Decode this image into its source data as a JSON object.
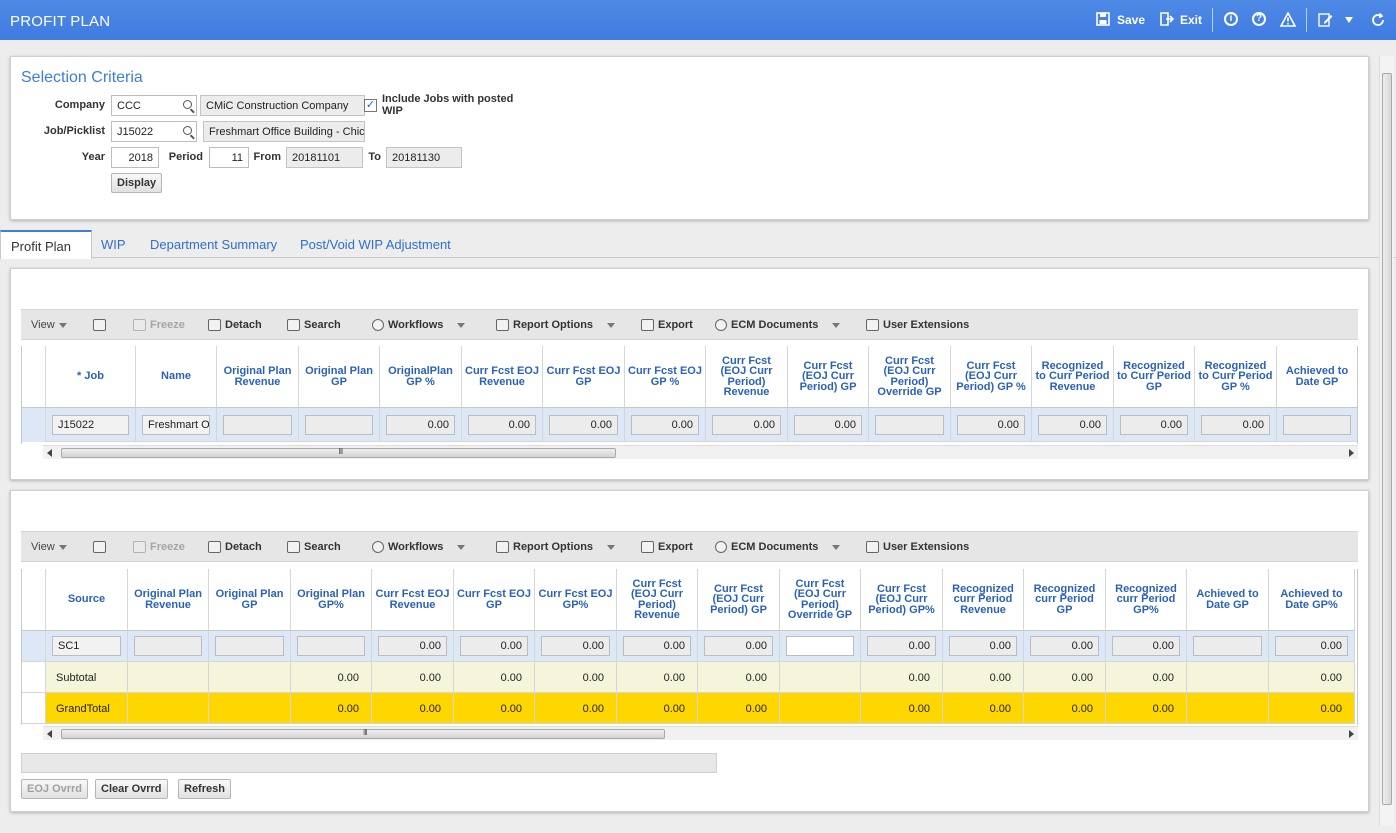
{
  "app": {
    "title": "PROFIT PLAN",
    "save_label": "Save",
    "exit_label": "Exit"
  },
  "selection": {
    "title": "Selection Criteria",
    "company_label": "Company",
    "company_code": "CCC",
    "company_name": "CMiC Construction Company",
    "include_wip_label_1": "Include Jobs with posted",
    "include_wip_label_2": "WIP",
    "include_wip_checked": "✓",
    "job_label": "Job/Picklist",
    "job_code": "J15022",
    "job_name": "Freshmart Office Building - Chic",
    "year_label": "Year",
    "year_value": "2018",
    "period_label": "Period",
    "period_value": "11",
    "from_label": "From",
    "from_value": "20181101",
    "to_label": "To",
    "to_value": "20181130",
    "display_button": "Display"
  },
  "tabs": [
    "Profit Plan",
    "WIP",
    "Department Summary",
    "Post/Void WIP Adjustment"
  ],
  "toolbar": {
    "view": "View",
    "freeze": "Freeze",
    "detach": "Detach",
    "search": "Search",
    "workflows": "Workflows",
    "report_options": "Report Options",
    "export": "Export",
    "ecm_documents": "ECM Documents",
    "user_extensions": "User Extensions"
  },
  "grid1": {
    "headers": [
      "* Job",
      "Name",
      "Original Plan Revenue",
      "Original Plan GP",
      "OriginalPlan GP %",
      "Curr Fcst EOJ Revenue",
      "Curr Fcst EOJ GP",
      "Curr Fcst EOJ GP %",
      "Curr Fcst (EOJ Curr Period) Revenue",
      "Curr Fcst (EOJ Curr Period) GP",
      "Curr Fcst (EOJ Curr Period) Override GP",
      "Curr Fcst (EOJ Curr Period) GP %",
      "Recognized to Curr Period Revenue",
      "Recognized to Curr Period GP",
      "Recognized to Curr Period GP %",
      "Achieved to Date GP"
    ],
    "row": [
      "J15022",
      "Freshmart Office Building - Chicago",
      "",
      "",
      "0.00",
      "0.00",
      "0.00",
      "0.00",
      "0.00",
      "0.00",
      "",
      "0.00",
      "0.00",
      "0.00",
      "0.00",
      ""
    ]
  },
  "grid2": {
    "headers": [
      "Source",
      "Original Plan Revenue",
      "Original Plan GP",
      "Original Plan GP%",
      "Curr Fcst EOJ Revenue",
      "Curr Fcst EOJ GP",
      "Curr Fcst EOJ GP%",
      "Curr Fcst (EOJ Curr Period) Revenue",
      "Curr Fcst (EOJ Curr Period) GP",
      "Curr Fcst (EOJ Curr Period) Override GP",
      "Curr Fcst (EOJ Curr Period) GP%",
      "Recognized curr Period Revenue",
      "Recognized curr Period GP",
      "Recognized curr Period GP%",
      "Achieved to Date GP",
      "Achieved to Date GP%"
    ],
    "row_input": [
      "SC1",
      "",
      "",
      "",
      "0.00",
      "0.00",
      "0.00",
      "0.00",
      "0.00",
      "",
      "0.00",
      "0.00",
      "0.00",
      "0.00",
      "",
      "0.00"
    ],
    "row_subtotal": [
      "Subtotal",
      "",
      "",
      "0.00",
      "0.00",
      "0.00",
      "0.00",
      "0.00",
      "0.00",
      "",
      "0.00",
      "0.00",
      "0.00",
      "0.00",
      "",
      "0.00"
    ],
    "row_grandtotal": [
      "GrandTotal",
      "",
      "",
      "0.00",
      "0.00",
      "0.00",
      "0.00",
      "0.00",
      "0.00",
      "",
      "0.00",
      "0.00",
      "0.00",
      "0.00",
      "",
      "0.00"
    ]
  },
  "bottom_buttons": {
    "eoj_ovrrd": "EOJ Ovrrd",
    "clear_ovrrd": "Clear Ovrrd",
    "refresh": "Refresh"
  },
  "colors": {
    "header_blue": "#4a86e8",
    "subtotal_bg": "#f5f5dc",
    "grandtotal_bg": "#ffd700",
    "selected_row_bg": "#dde8f7"
  }
}
